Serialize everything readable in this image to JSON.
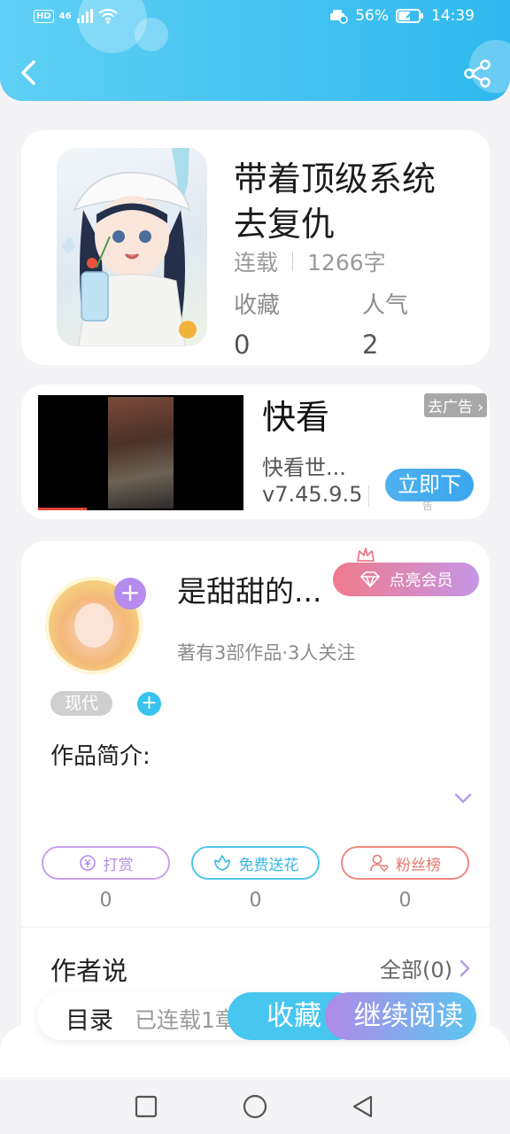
{
  "status_bar": {
    "hd": "HD",
    "signal_label": "46",
    "battery": "56%",
    "time": "14:39"
  },
  "book": {
    "title": "带着顶级系统去复仇",
    "status": "连载",
    "word_count": "1266字",
    "collect_label": "收藏",
    "collect_value": "0",
    "popularity_label": "人气",
    "popularity_value": "2"
  },
  "ad": {
    "title": "快看",
    "tag": "去广告",
    "description": "快看世...",
    "version": "v7.45.9.5",
    "button": "立即下",
    "small_label": "告"
  },
  "author": {
    "name": "是甜甜的...",
    "vip_button": "点亮会员",
    "info": "著有3部作品·3人关注",
    "tag": "现代",
    "intro_label": "作品简介:"
  },
  "actions": [
    {
      "label": "打赏",
      "count": "0",
      "color": "#c9a2ea"
    },
    {
      "label": "免费送花",
      "count": "0",
      "color": "#4fc6ec"
    },
    {
      "label": "粉丝榜",
      "count": "0",
      "color": "#ef8a82"
    }
  ],
  "author_says": {
    "label": "作者说",
    "all_link": "全部(0)"
  },
  "bottom_bar": {
    "toc": "目录",
    "serial": "已连载1章",
    "favorite": "收藏",
    "continue": "继续阅读"
  }
}
